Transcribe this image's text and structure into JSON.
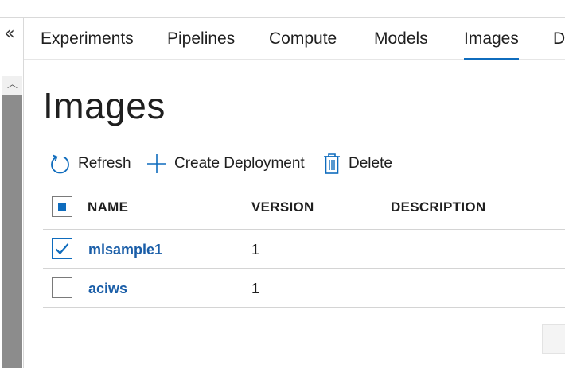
{
  "nav": {
    "collapse_glyph": "«",
    "tabs": [
      {
        "label": "Experiments",
        "active": false
      },
      {
        "label": "Pipelines",
        "active": false
      },
      {
        "label": "Compute",
        "active": false
      },
      {
        "label": "Models",
        "active": false
      },
      {
        "label": "Images",
        "active": true
      },
      {
        "label": "D",
        "active": false
      }
    ]
  },
  "page": {
    "title": "Images"
  },
  "toolbar": {
    "refresh_label": "Refresh",
    "create_label": "Create Deployment",
    "delete_label": "Delete"
  },
  "table": {
    "header_selection": "partial",
    "columns": {
      "name": "NAME",
      "version": "VERSION",
      "description": "DESCRIPTION"
    },
    "rows": [
      {
        "name": "mlsample1",
        "version": "1",
        "description": "",
        "selected": true
      },
      {
        "name": "aciws",
        "version": "1",
        "description": "",
        "selected": false
      }
    ]
  },
  "colors": {
    "accent": "#0f6cbd",
    "link": "#1a5ea8",
    "scrollbar_thumb": "#8c8c8c"
  },
  "icons": {
    "collapse": "double-chevron-left-icon",
    "refresh": "refresh-icon",
    "create": "plus-icon",
    "delete": "trash-icon",
    "scroll_up": "chevron-up-icon",
    "check": "checkmark-icon"
  }
}
